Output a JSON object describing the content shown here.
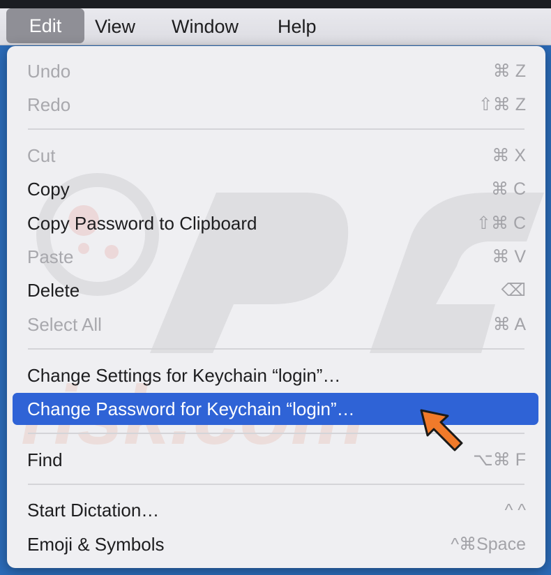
{
  "menubar": {
    "items": [
      "Edit",
      "View",
      "Window",
      "Help"
    ]
  },
  "menu": {
    "items": [
      {
        "label": "Undo",
        "shortcut": "⌘ Z"
      },
      {
        "label": "Redo",
        "shortcut": "⇧⌘ Z"
      },
      {
        "label": "Cut",
        "shortcut": "⌘ X"
      },
      {
        "label": "Copy",
        "shortcut": "⌘ C"
      },
      {
        "label": "Copy Password to Clipboard",
        "shortcut": "⇧⌘ C"
      },
      {
        "label": "Paste",
        "shortcut": "⌘ V"
      },
      {
        "label": "Delete",
        "shortcut": "⌫"
      },
      {
        "label": "Select All",
        "shortcut": "⌘ A"
      },
      {
        "label": "Change Settings for Keychain “login”…",
        "shortcut": ""
      },
      {
        "label": "Change Password for Keychain “login”…",
        "shortcut": ""
      },
      {
        "label": "Find",
        "shortcut": "⌥⌘ F"
      },
      {
        "label": "Start Dictation…",
        "shortcut": "^ ^"
      },
      {
        "label": "Emoji & Symbols",
        "shortcut": "^⌘Space"
      }
    ]
  },
  "colors": {
    "highlight": "#2f63d6",
    "arrow": "#f07a2a",
    "disabled_text": "#a8a8ad"
  },
  "icons": {
    "pointer": "arrow-pointer-icon",
    "watermark": "pcrisk-watermark"
  }
}
